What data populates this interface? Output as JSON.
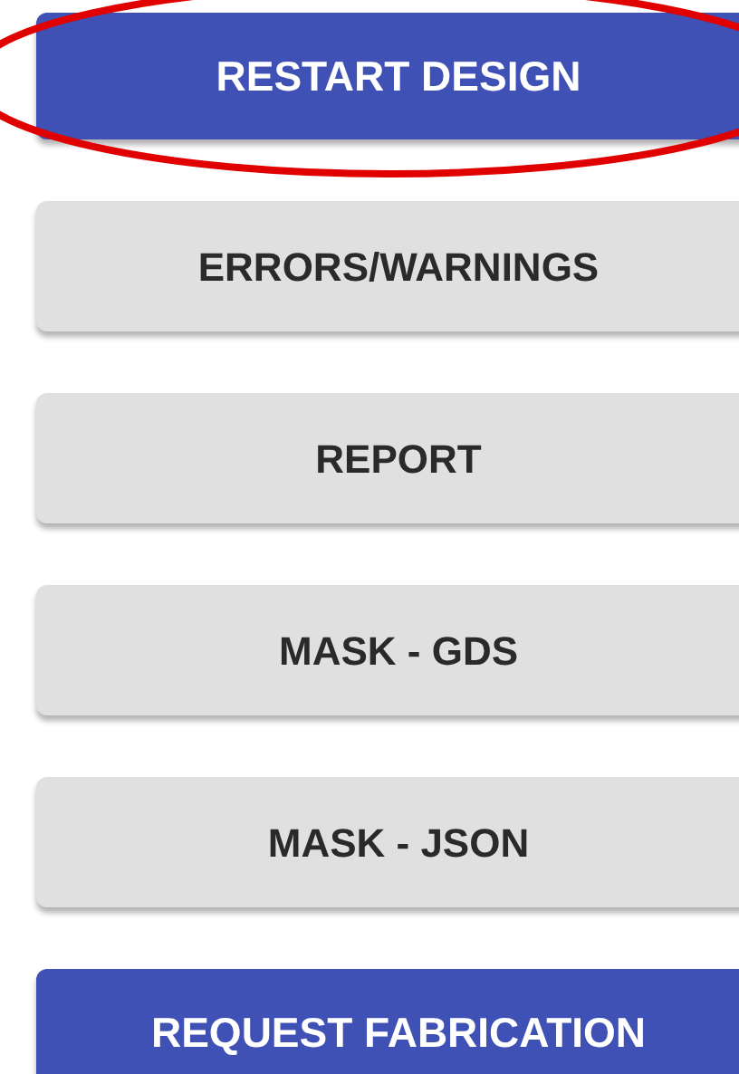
{
  "buttons": [
    {
      "label": "RESTART DESIGN",
      "kind": "primary"
    },
    {
      "label": "ERRORS/WARNINGS",
      "kind": "secondary"
    },
    {
      "label": "REPORT",
      "kind": "secondary"
    },
    {
      "label": "MASK - GDS",
      "kind": "secondary"
    },
    {
      "label": "MASK - JSON",
      "kind": "secondary"
    },
    {
      "label": "REQUEST FABRICATION",
      "kind": "primary"
    }
  ],
  "annotations": [
    {
      "kind": "ellipse",
      "color": "#e00000"
    }
  ]
}
